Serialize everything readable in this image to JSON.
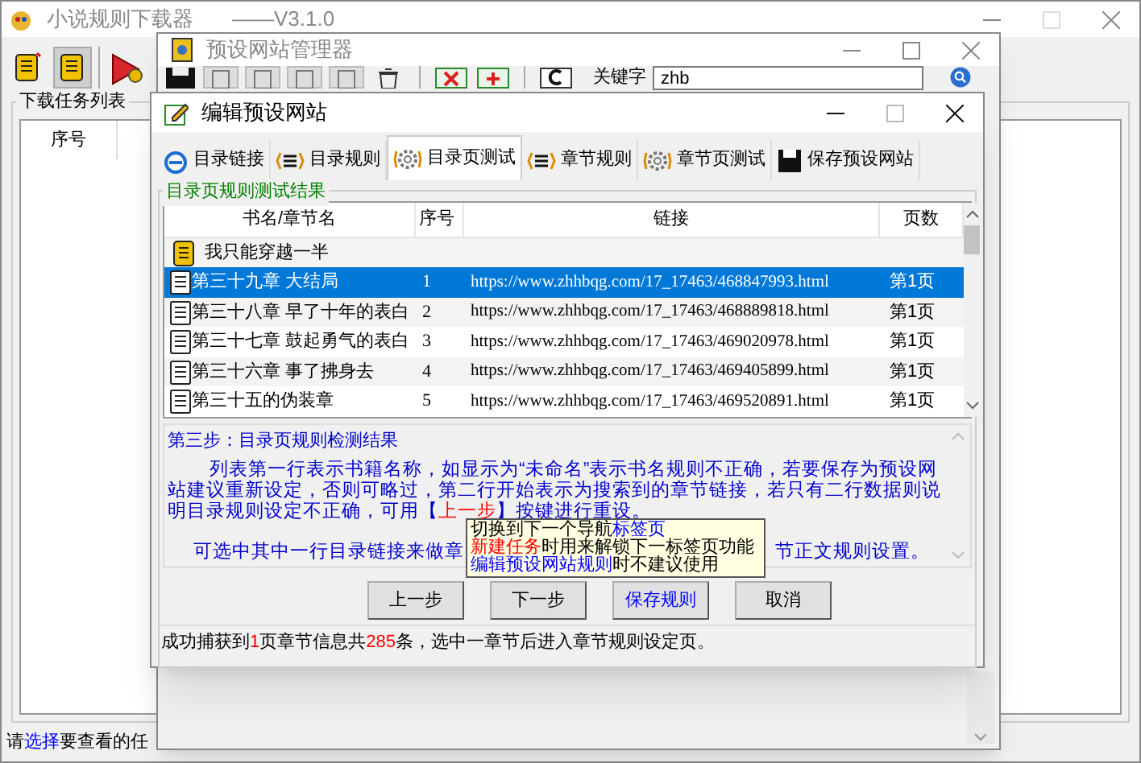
{
  "main_window": {
    "title": "小说规则下载器",
    "version": "——V3.1.0",
    "task_panel": {
      "label": "下载任务列表",
      "columns": [
        "序号"
      ]
    },
    "status": [
      {
        "text": "请",
        "kind": "plain"
      },
      {
        "text": "选择",
        "kind": "accent"
      },
      {
        "text": "要查看的任",
        "kind": "plain"
      }
    ]
  },
  "manager_window": {
    "title": "预设网站管理器",
    "keyword_label": "关键字",
    "keyword_value": "zhb"
  },
  "edit_window": {
    "title": "编辑预设网站",
    "tabs": [
      {
        "label": "目录链接",
        "selected": false
      },
      {
        "label": "目录规则",
        "selected": false
      },
      {
        "label": "目录页测试",
        "selected": true
      },
      {
        "label": "章节规则",
        "selected": false
      },
      {
        "label": "章节页测试",
        "selected": false
      },
      {
        "label": "保存预设网站",
        "selected": false
      }
    ],
    "group_label": "目录页规则测试结果",
    "table": {
      "columns": [
        "书名/章节名",
        "序号",
        "链接",
        "页数"
      ],
      "rows": [
        {
          "kind": "book",
          "name": "我只能穿越一半",
          "selected": false
        },
        {
          "kind": "chapter",
          "name": "第三十九章 大结局",
          "index": "1",
          "link": "https://www.zhhbqg.com/17_17463/468847993.html",
          "page": "第1页",
          "selected": true
        },
        {
          "kind": "chapter",
          "name": "第三十八章 早了十年的表白",
          "index": "2",
          "link": "https://www.zhhbqg.com/17_17463/468889818.html",
          "page": "第1页",
          "selected": false
        },
        {
          "kind": "chapter",
          "name": "第三十七章 鼓起勇气的表白",
          "index": "3",
          "link": "https://www.zhhbqg.com/17_17463/469020978.html",
          "page": "第1页",
          "selected": false
        },
        {
          "kind": "chapter",
          "name": "第三十六章 事了拂身去",
          "index": "4",
          "link": "https://www.zhhbqg.com/17_17463/469405899.html",
          "page": "第1页",
          "selected": false
        },
        {
          "kind": "chapter",
          "name": "第三十五的伪装章",
          "index": "5",
          "link": "https://www.zhhbqg.com/17_17463/469520891.html",
          "page": "第1页",
          "selected": false
        }
      ]
    },
    "step_title": "第三步：目录页规则检测结果",
    "paragraph": [
      {
        "text": "列表第一行表示书籍名称，如显示为“未命名”表示书名规则不正确，若要保存为预设网站建议重新设定，否则可略过，第二行开始表示为搜索到的章节链接，若只有二行数据则说明目录规则设定不正确，可用",
        "kind": "plain"
      },
      {
        "text": "【",
        "kind": "plain"
      },
      {
        "text": "上一步",
        "kind": "alert"
      },
      {
        "text": "】按键进行重设。",
        "kind": "plain"
      }
    ],
    "paragraph_2_parts": [
      "可选中其中一行目录链接来做章",
      "节正文规则设置。"
    ],
    "buttons": [
      {
        "label": "上一步",
        "kind": "normal"
      },
      {
        "label": "下一步",
        "kind": "normal"
      },
      {
        "label": "保存规则",
        "kind": "primary"
      },
      {
        "label": "取消",
        "kind": "normal"
      }
    ],
    "status": [
      {
        "text": "成功捕获到",
        "kind": "plain"
      },
      {
        "text": "1",
        "kind": "alert"
      },
      {
        "text": "页章节信息共",
        "kind": "plain"
      },
      {
        "text": "285",
        "kind": "alert"
      },
      {
        "text": "条，选中一章节后进入章节规则设定页。",
        "kind": "plain"
      }
    ],
    "tooltip": [
      [
        {
          "text": "切换到下一个导航",
          "kind": "plain"
        },
        {
          "text": "标签页",
          "kind": "accent"
        }
      ],
      [
        {
          "text": "新建任务",
          "kind": "alert"
        },
        {
          "text": "时用来解锁下一标签页功能",
          "kind": "plain"
        }
      ],
      [
        {
          "text": "编辑预设网站规则",
          "kind": "accent"
        },
        {
          "text": "时不建议使用",
          "kind": "plain"
        }
      ]
    ]
  }
}
